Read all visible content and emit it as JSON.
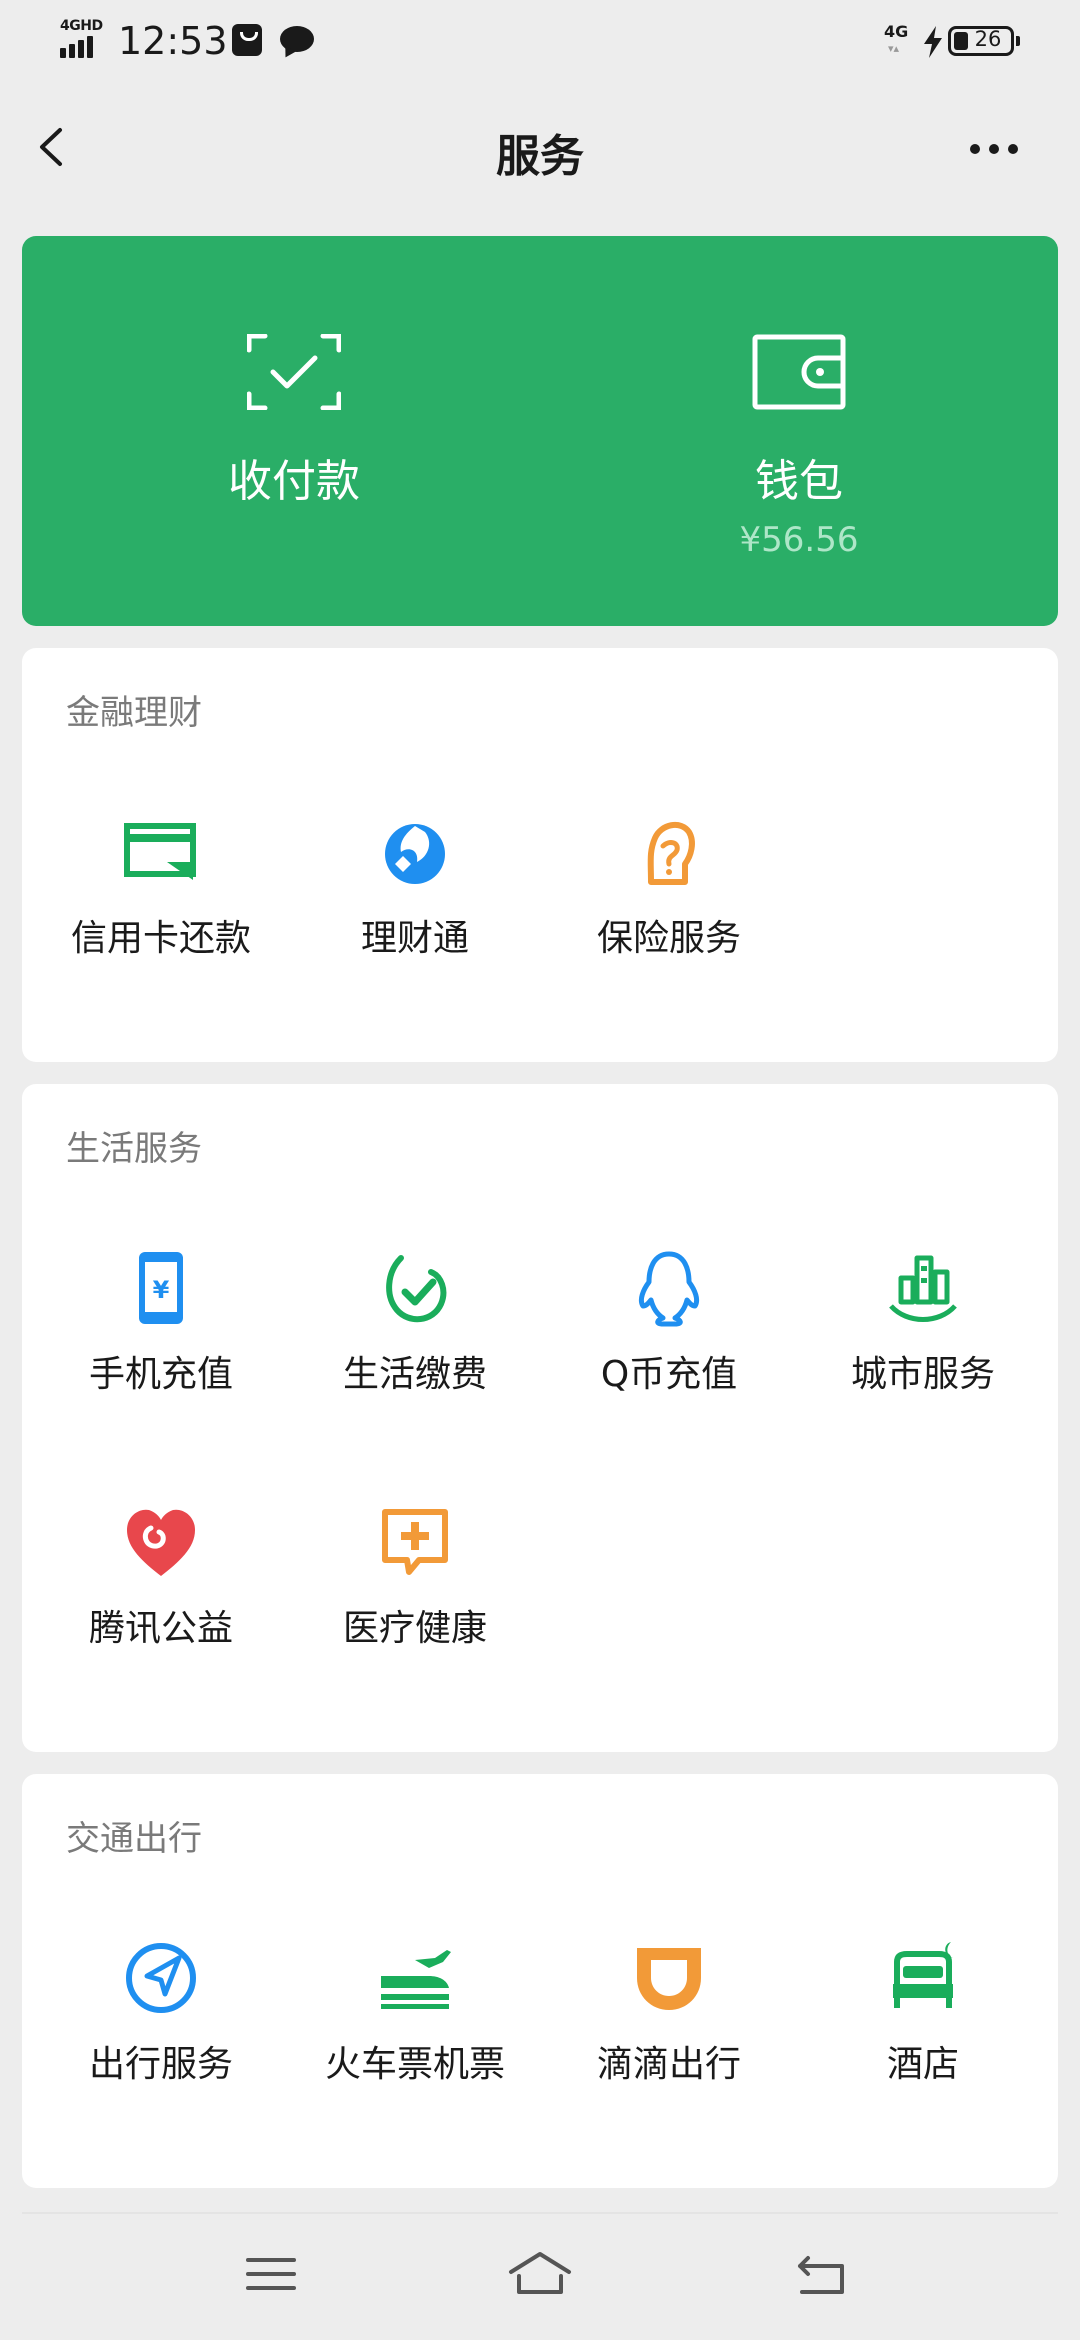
{
  "status_bar": {
    "network": "4GHD",
    "time": "12:53",
    "net_right": "4G",
    "battery": "26"
  },
  "nav": {
    "title": "服务"
  },
  "pay_card": {
    "receive_pay": {
      "label": "收付款",
      "icon": "scan-check-icon"
    },
    "wallet": {
      "label": "钱包",
      "balance": "¥56.56",
      "icon": "wallet-icon"
    },
    "color": "#2aae67"
  },
  "sections": {
    "finance": {
      "title": "金融理财",
      "items": [
        {
          "label": "信用卡还款",
          "icon": "credit-card-icon",
          "color": "#1aad5b"
        },
        {
          "label": "理财通",
          "icon": "licaitong-icon",
          "color": "#1f8ff0"
        },
        {
          "label": "保险服务",
          "icon": "insurance-icon",
          "color": "#f29a38"
        }
      ]
    },
    "life": {
      "title": "生活服务",
      "items": [
        {
          "label": "手机充值",
          "icon": "phone-recharge-icon",
          "color": "#1f8ff0"
        },
        {
          "label": "生活缴费",
          "icon": "utility-payment-icon",
          "color": "#1aad5b"
        },
        {
          "label": "Q币充值",
          "icon": "qq-penguin-icon",
          "color": "#1f8ff0"
        },
        {
          "label": "城市服务",
          "icon": "city-service-icon",
          "color": "#1aad5b"
        },
        {
          "label": "腾讯公益",
          "icon": "charity-heart-icon",
          "color": "#e8474c"
        },
        {
          "label": "医疗健康",
          "icon": "medical-icon",
          "color": "#f29a38"
        }
      ]
    },
    "transport": {
      "title": "交通出行",
      "items": [
        {
          "label": "出行服务",
          "icon": "navigation-icon",
          "color": "#1f8ff0"
        },
        {
          "label": "火车票机票",
          "icon": "train-plane-icon",
          "color": "#1aad5b"
        },
        {
          "label": "滴滴出行",
          "icon": "didi-icon",
          "color": "#f29a38"
        },
        {
          "label": "酒店",
          "icon": "hotel-bed-icon",
          "color": "#1aad5b"
        }
      ]
    }
  }
}
